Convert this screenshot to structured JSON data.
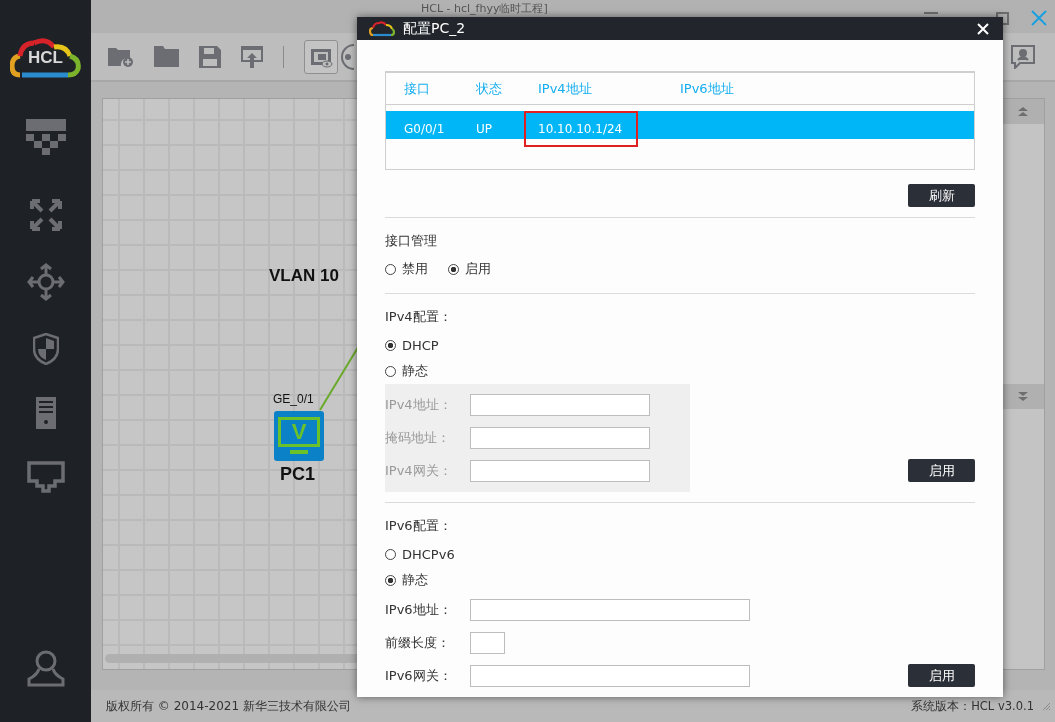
{
  "app": {
    "logo_text": "HCL",
    "title": "HCL - hcl_fhyy临时工程]"
  },
  "canvas": {
    "labels": [
      "VLAN 10"
    ],
    "nodes": [
      {
        "label": "PC1",
        "port": "GE_0/1",
        "icon_letter": "V"
      }
    ]
  },
  "dialog": {
    "title": "配置PC_2",
    "table": {
      "columns": [
        "接口",
        "状态",
        "IPv4地址",
        "IPv6地址"
      ],
      "rows": [
        {
          "selected": true,
          "cells": [
            {
              "text": "G0/0/1",
              "marked": false
            },
            {
              "text": "UP",
              "marked": false
            },
            {
              "text": "10.10.10.1/24",
              "marked": true
            }
          ]
        }
      ]
    },
    "refresh_button": "刷新",
    "interface_mgmt": {
      "title": "接口管理",
      "options": [
        {
          "label": "禁用",
          "selected": false
        },
        {
          "label": "启用",
          "selected": true
        }
      ]
    },
    "ipv4": {
      "title": "IPv4配置：",
      "disabled": true,
      "options": [
        {
          "label": "DHCP",
          "selected": true
        },
        {
          "label": "静态",
          "selected": false
        }
      ],
      "fields": [
        {
          "label": "IPv4地址：",
          "kind": "medium"
        },
        {
          "label": "掩码地址：",
          "kind": "medium"
        },
        {
          "label": "IPv4网关：",
          "kind": "medium"
        }
      ],
      "apply_button": "启用"
    },
    "ipv6": {
      "title": "IPv6配置：",
      "disabled": false,
      "options": [
        {
          "label": "DHCPv6",
          "selected": false
        },
        {
          "label": "静态",
          "selected": true
        }
      ],
      "fields": [
        {
          "label": "IPv6地址：",
          "kind": "wide"
        },
        {
          "label": "前缀长度：",
          "kind": "narrow"
        },
        {
          "label": "IPv6网关：",
          "kind": "wide"
        }
      ],
      "apply_button": "启用"
    }
  },
  "footer": {
    "copyright": "版权所有 © 2014-2021 新华三技术有限公司",
    "version": "系统版本：HCL v3.0.1"
  }
}
